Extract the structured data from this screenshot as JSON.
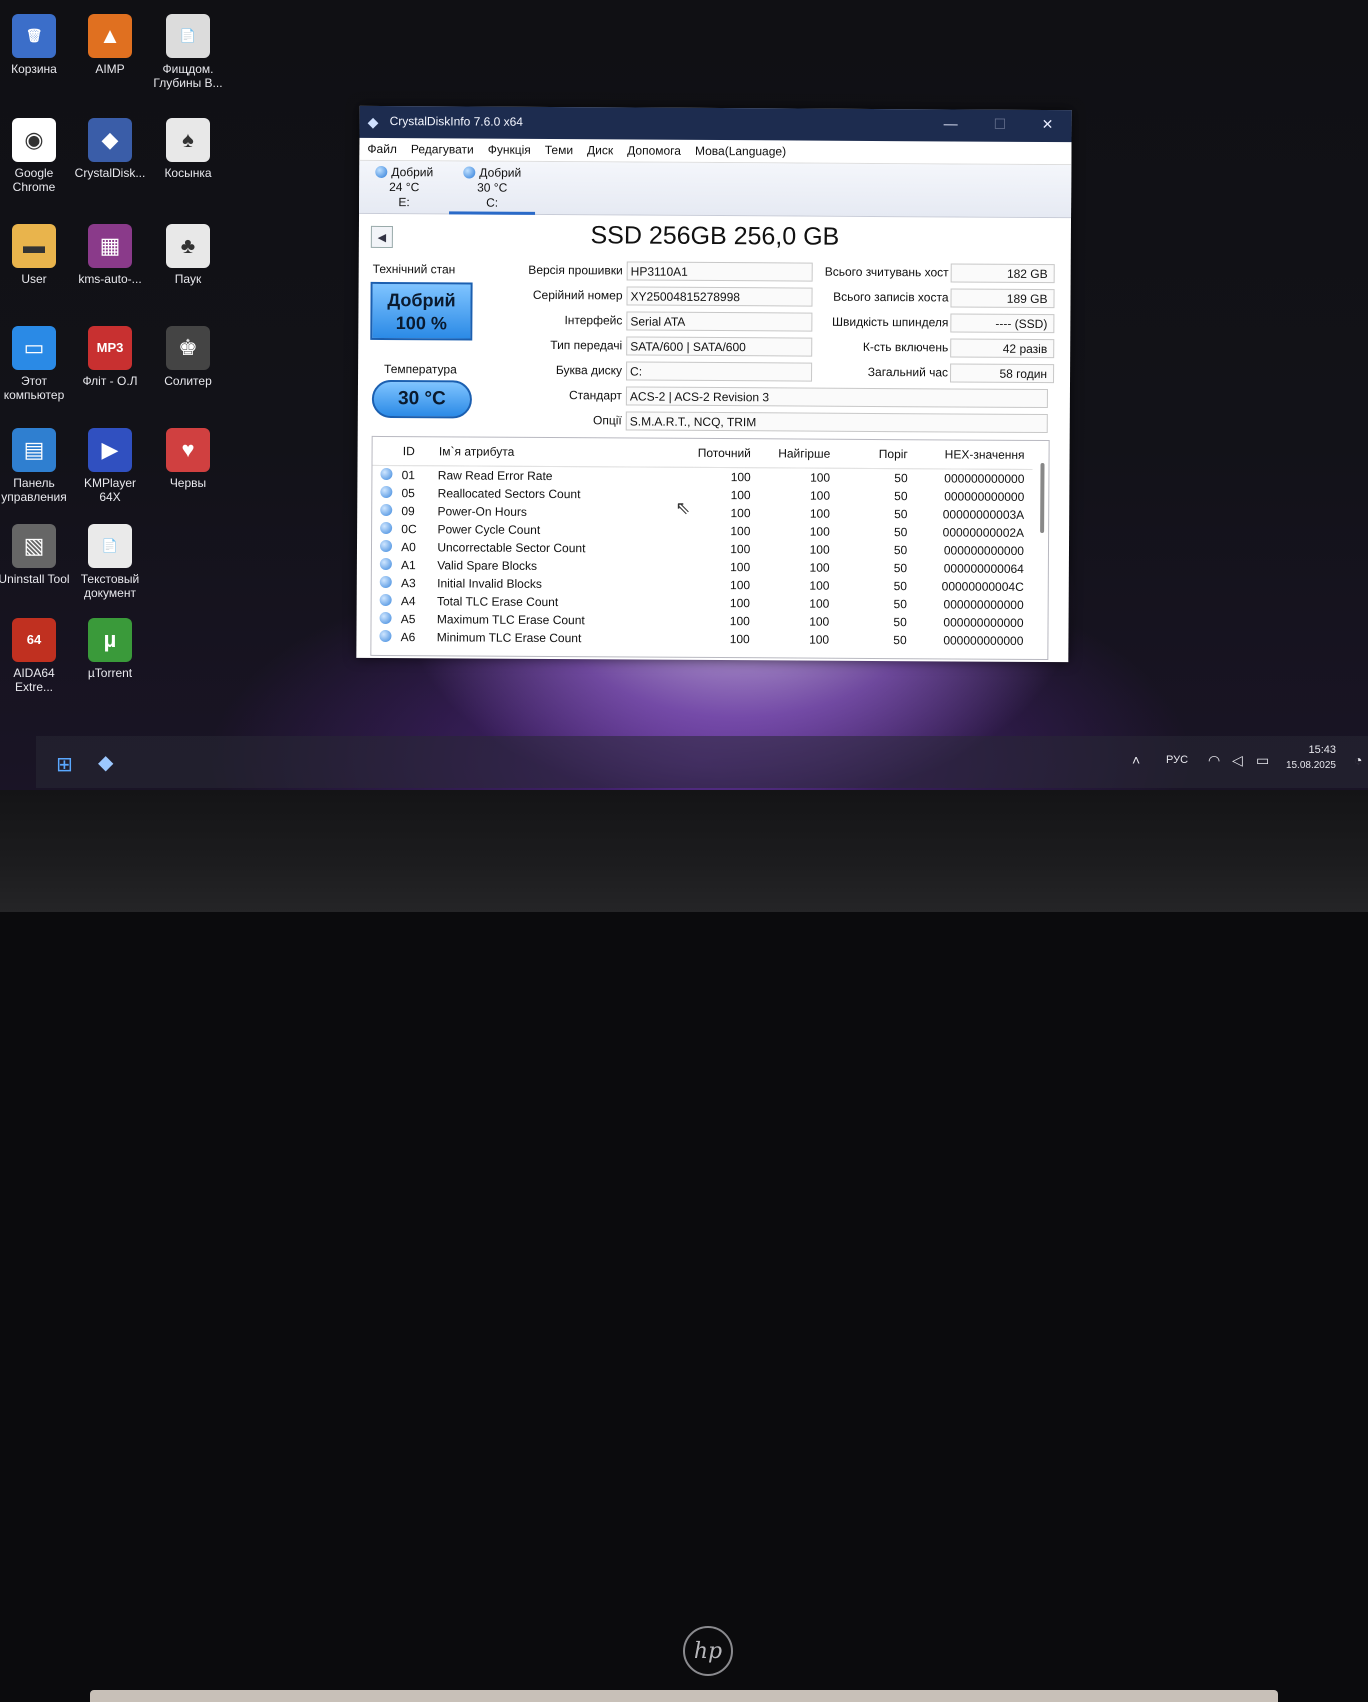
{
  "desktop": {
    "icons": [
      {
        "label": "Корзина",
        "icon": "recycle-bin-icon",
        "glyph": "🗑"
      },
      {
        "label": "AIMP",
        "icon": "aimp-icon",
        "glyph": "▲"
      },
      {
        "label": "Фищдом. Глубины В...",
        "icon": "document-icon",
        "glyph": "📄"
      },
      {
        "label": "Google Chrome",
        "icon": "chrome-icon",
        "glyph": "◉"
      },
      {
        "label": "CrystalDisk...",
        "icon": "crystaldisk-icon",
        "glyph": "◆"
      },
      {
        "label": "Косынка",
        "icon": "solitaire-icon",
        "glyph": "♠"
      },
      {
        "label": "User",
        "icon": "folder-icon",
        "glyph": "▬"
      },
      {
        "label": "kms-auto-...",
        "icon": "archive-icon",
        "glyph": "▦"
      },
      {
        "label": "Паук",
        "icon": "spider-solitaire-icon",
        "glyph": "♣"
      },
      {
        "label": "Этот компьютер",
        "icon": "computer-icon",
        "glyph": "▭"
      },
      {
        "label": "Фліт - О.Л",
        "icon": "mp3-icon",
        "glyph": "MP3"
      },
      {
        "label": "Солитер",
        "icon": "solitaire-king-icon",
        "glyph": "♚"
      },
      {
        "label": "Панель управления",
        "icon": "control-panel-icon",
        "glyph": "▤"
      },
      {
        "label": "KMPlayer 64X",
        "icon": "kmplayer-icon",
        "glyph": "▶"
      },
      {
        "label": "Червы",
        "icon": "hearts-icon",
        "glyph": "♥"
      },
      {
        "label": "Uninstall Tool",
        "icon": "uninstall-tool-icon",
        "glyph": "▧"
      },
      {
        "label": "Текстовый документ",
        "icon": "text-document-icon",
        "glyph": "📄"
      },
      {
        "label": "AIDA64 Extre...",
        "icon": "aida64-icon",
        "glyph": "64"
      },
      {
        "label": "µTorrent",
        "icon": "utorrent-icon",
        "glyph": "µ"
      }
    ]
  },
  "taskbar": {
    "lang": "РУС",
    "time": "15:43",
    "date": "15.08.2025"
  },
  "window": {
    "title": "CrystalDiskInfo 7.6.0 x64",
    "menu": [
      "Файл",
      "Редагувати",
      "Функція",
      "Теми",
      "Диск",
      "Допомога",
      "Мова(Language)"
    ],
    "disks": [
      {
        "status": "Добрий",
        "temp": "24 °C",
        "letter": "E:"
      },
      {
        "status": "Добрий",
        "temp": "30 °C",
        "letter": "C:"
      }
    ],
    "disk_title": "SSD 256GB 256,0 GB",
    "health_label": "Технічний стан",
    "health_status": "Добрий",
    "health_percent": "100 %",
    "temp_label": "Температура",
    "temp_value": "30 °C",
    "fields": {
      "firmware_label": "Версія прошивки",
      "firmware": "HP3110A1",
      "serial_label": "Серійний номер",
      "serial": "XY25004815278998",
      "interface_label": "Інтерфейс",
      "interface": "Serial ATA",
      "transfer_label": "Тип передачі",
      "transfer": "SATA/600 | SATA/600",
      "letter_label": "Буква диску",
      "letter": "C:",
      "standard_label": "Стандарт",
      "standard": "ACS-2 | ACS-2 Revision 3",
      "options_label": "Опції",
      "options": "S.M.A.R.T., NCQ, TRIM",
      "reads_label": "Всього зчитувань хост",
      "reads": "182 GB",
      "writes_label": "Всього записів хоста",
      "writes": "189 GB",
      "rotation_label": "Швидкість шпинделя",
      "rotation": "---- (SSD)",
      "power_count_label": "К-сть включень",
      "power_count": "42 разів",
      "power_hours_label": "Загальний час",
      "power_hours": "58 годин"
    },
    "smart_headers": {
      "id": "ID",
      "name": "Ім`я атрибута",
      "current": "Поточний",
      "worst": "Найгірше",
      "threshold": "Поріг",
      "raw": "HEX-значення"
    },
    "smart_rows": [
      {
        "id": "01",
        "name": "Raw Read Error Rate",
        "current": "100",
        "worst": "100",
        "threshold": "50",
        "raw": "000000000000"
      },
      {
        "id": "05",
        "name": "Reallocated Sectors Count",
        "current": "100",
        "worst": "100",
        "threshold": "50",
        "raw": "000000000000"
      },
      {
        "id": "09",
        "name": "Power-On Hours",
        "current": "100",
        "worst": "100",
        "threshold": "50",
        "raw": "00000000003A"
      },
      {
        "id": "0C",
        "name": "Power Cycle Count",
        "current": "100",
        "worst": "100",
        "threshold": "50",
        "raw": "00000000002A"
      },
      {
        "id": "A0",
        "name": "Uncorrectable Sector Count",
        "current": "100",
        "worst": "100",
        "threshold": "50",
        "raw": "000000000000"
      },
      {
        "id": "A1",
        "name": "Valid Spare Blocks",
        "current": "100",
        "worst": "100",
        "threshold": "50",
        "raw": "000000000064"
      },
      {
        "id": "A3",
        "name": "Initial Invalid Blocks",
        "current": "100",
        "worst": "100",
        "threshold": "50",
        "raw": "00000000004C"
      },
      {
        "id": "A4",
        "name": "Total TLC Erase Count",
        "current": "100",
        "worst": "100",
        "threshold": "50",
        "raw": "000000000000"
      },
      {
        "id": "A5",
        "name": "Maximum TLC Erase Count",
        "current": "100",
        "worst": "100",
        "threshold": "50",
        "raw": "000000000000"
      },
      {
        "id": "A6",
        "name": "Minimum TLC Erase Count",
        "current": "100",
        "worst": "100",
        "threshold": "50",
        "raw": "000000000000"
      }
    ]
  }
}
